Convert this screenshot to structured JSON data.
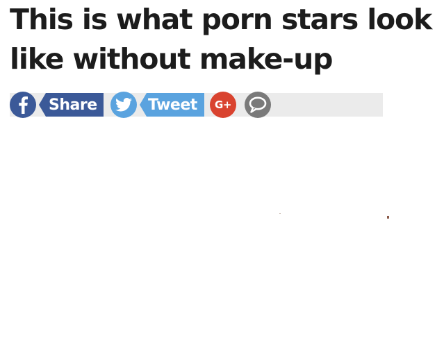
{
  "article": {
    "title": "This is what porn stars look like without make-up"
  },
  "share_bar": {
    "facebook": {
      "icon": "facebook-icon",
      "label": "Share",
      "color": "#3b5998"
    },
    "twitter": {
      "icon": "twitter-bird-icon",
      "label": "Tweet",
      "color": "#5aa3df"
    },
    "google_plus": {
      "icon": "google-plus-icon",
      "glyph": "G+",
      "color": "#d9432f"
    },
    "comments": {
      "icon": "comment-bubble-icon",
      "color": "#7a7a7a"
    },
    "bar_color": "#ebebeb"
  }
}
